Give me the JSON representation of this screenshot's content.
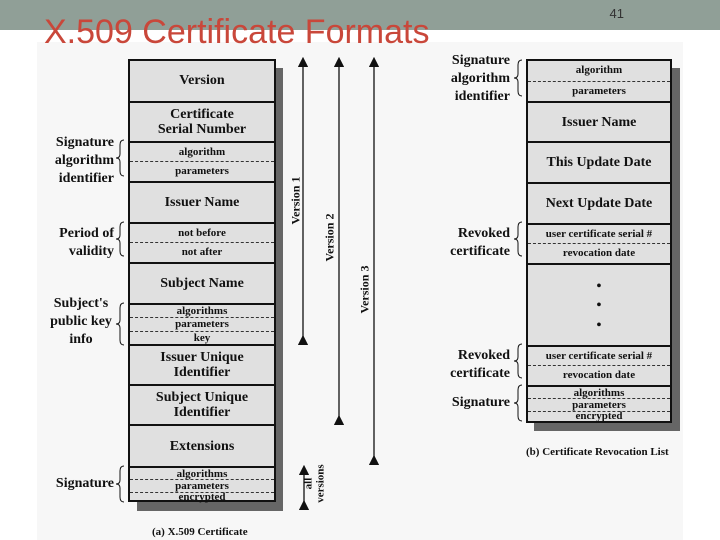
{
  "slide": {
    "title": "X.509 Certificate Formats",
    "page_number": "41",
    "colors": {
      "title": "#c9473a",
      "band": "#909f97",
      "box_fill": "#e0e0e0"
    }
  },
  "certificate": {
    "caption": "(a) X.509 Certificate",
    "fields": {
      "version": "Version",
      "serial_1": "Certificate",
      "serial_2": "Serial Number",
      "sig_algorithm": "algorithm",
      "sig_parameters": "parameters",
      "issuer_name": "Issuer Name",
      "not_before": "not before",
      "not_after": "not after",
      "subject_name": "Subject Name",
      "pk_algorithms": "algorithms",
      "pk_parameters": "parameters",
      "pk_key": "key",
      "issuer_uid_1": "Issuer Unique",
      "issuer_uid_2": "Identifier",
      "subject_uid_1": "Subject Unique",
      "subject_uid_2": "Identifier",
      "extensions": "Extensions",
      "s_algorithms": "algorithms",
      "s_parameters": "parameters",
      "s_encrypted": "encrypted"
    },
    "labels": {
      "sig_alg_id": [
        "Signature",
        "algorithm",
        "identifier"
      ],
      "validity": [
        "Period of",
        "validity"
      ],
      "public_key": [
        "Subject's",
        "public key",
        "info"
      ],
      "signature": "Signature"
    },
    "versions": {
      "v1": "Version 1",
      "v2": "Version 2",
      "v3": "Version 3",
      "all_1": "all",
      "all_2": "versions"
    }
  },
  "crl": {
    "caption": "(b) Certificate Revocation List",
    "fields": {
      "sig_algorithm": "algorithm",
      "sig_parameters": "parameters",
      "issuer_name": "Issuer Name",
      "this_update": "This Update Date",
      "next_update": "Next Update Date",
      "rev1_serial": "user certificate serial #",
      "rev1_date": "revocation date",
      "ellipsis": "•",
      "rev2_serial": "user certificate serial #",
      "rev2_date": "revocation date",
      "s_algorithms": "algorithms",
      "s_parameters": "parameters",
      "s_encrypted": "encrypted"
    },
    "labels": {
      "sig_alg_id": [
        "Signature",
        "algorithm",
        "identifier"
      ],
      "revoked_1": [
        "Revoked",
        "certificate"
      ],
      "revoked_2": [
        "Revoked",
        "certificate"
      ],
      "signature": "Signature"
    }
  }
}
